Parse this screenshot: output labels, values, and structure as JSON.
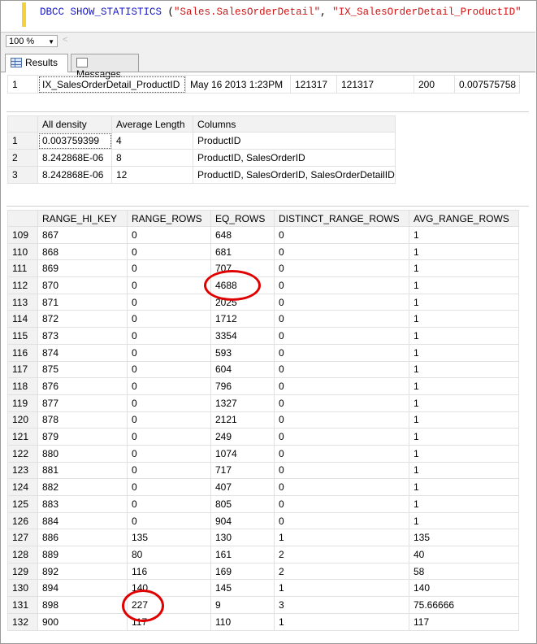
{
  "editor": {
    "keyword": "DBCC SHOW_STATISTICS",
    "open": " (",
    "arg1": "\"Sales.SalesOrderDetail\"",
    "comma": ", ",
    "arg2": "\"IX_SalesOrderDetail_ProductID\""
  },
  "zoom": {
    "value": "100 %",
    "scroll_arrow": "<"
  },
  "tabs": [
    {
      "label": "Results",
      "icon": "results-grid-icon",
      "active": true
    },
    {
      "label": "Messages",
      "icon": "messages-icon",
      "active": false
    }
  ],
  "header_grid": {
    "row": [
      "1",
      "IX_SalesOrderDetail_ProductID",
      "May 16 2013  1:23PM",
      "121317",
      "121317",
      "200",
      "0.007575758"
    ]
  },
  "density_grid": {
    "columns": [
      "All density",
      "Average Length",
      "Columns"
    ],
    "rows": [
      [
        "1",
        "0.003759399",
        "4",
        "ProductID"
      ],
      [
        "2",
        "8.242868E-06",
        "8",
        "ProductID, SalesOrderID"
      ],
      [
        "3",
        "8.242868E-06",
        "12",
        "ProductID, SalesOrderID, SalesOrderDetailID"
      ]
    ]
  },
  "histogram_grid": {
    "columns": [
      "RANGE_HI_KEY",
      "RANGE_ROWS",
      "EQ_ROWS",
      "DISTINCT_RANGE_ROWS",
      "AVG_RANGE_ROWS"
    ],
    "rows": [
      [
        "109",
        "867",
        "0",
        "648",
        "0",
        "1"
      ],
      [
        "110",
        "868",
        "0",
        "681",
        "0",
        "1"
      ],
      [
        "111",
        "869",
        "0",
        "707",
        "0",
        "1"
      ],
      [
        "112",
        "870",
        "0",
        "4688",
        "0",
        "1"
      ],
      [
        "113",
        "871",
        "0",
        "2025",
        "0",
        "1"
      ],
      [
        "114",
        "872",
        "0",
        "1712",
        "0",
        "1"
      ],
      [
        "115",
        "873",
        "0",
        "3354",
        "0",
        "1"
      ],
      [
        "116",
        "874",
        "0",
        "593",
        "0",
        "1"
      ],
      [
        "117",
        "875",
        "0",
        "604",
        "0",
        "1"
      ],
      [
        "118",
        "876",
        "0",
        "796",
        "0",
        "1"
      ],
      [
        "119",
        "877",
        "0",
        "1327",
        "0",
        "1"
      ],
      [
        "120",
        "878",
        "0",
        "2121",
        "0",
        "1"
      ],
      [
        "121",
        "879",
        "0",
        "249",
        "0",
        "1"
      ],
      [
        "122",
        "880",
        "0",
        "1074",
        "0",
        "1"
      ],
      [
        "123",
        "881",
        "0",
        "717",
        "0",
        "1"
      ],
      [
        "124",
        "882",
        "0",
        "407",
        "0",
        "1"
      ],
      [
        "125",
        "883",
        "0",
        "805",
        "0",
        "1"
      ],
      [
        "126",
        "884",
        "0",
        "904",
        "0",
        "1"
      ],
      [
        "127",
        "886",
        "135",
        "130",
        "1",
        "135"
      ],
      [
        "128",
        "889",
        "80",
        "161",
        "2",
        "40"
      ],
      [
        "129",
        "892",
        "116",
        "169",
        "2",
        "58"
      ],
      [
        "130",
        "894",
        "140",
        "145",
        "1",
        "140"
      ],
      [
        "131",
        "898",
        "227",
        "9",
        "3",
        "75.66666"
      ],
      [
        "132",
        "900",
        "117",
        "110",
        "1",
        "117"
      ]
    ]
  },
  "colors": {
    "annotation": "#e00000",
    "keyword": "#1818c8",
    "string": "#d01414",
    "editor_margin": "#f5d23a"
  }
}
